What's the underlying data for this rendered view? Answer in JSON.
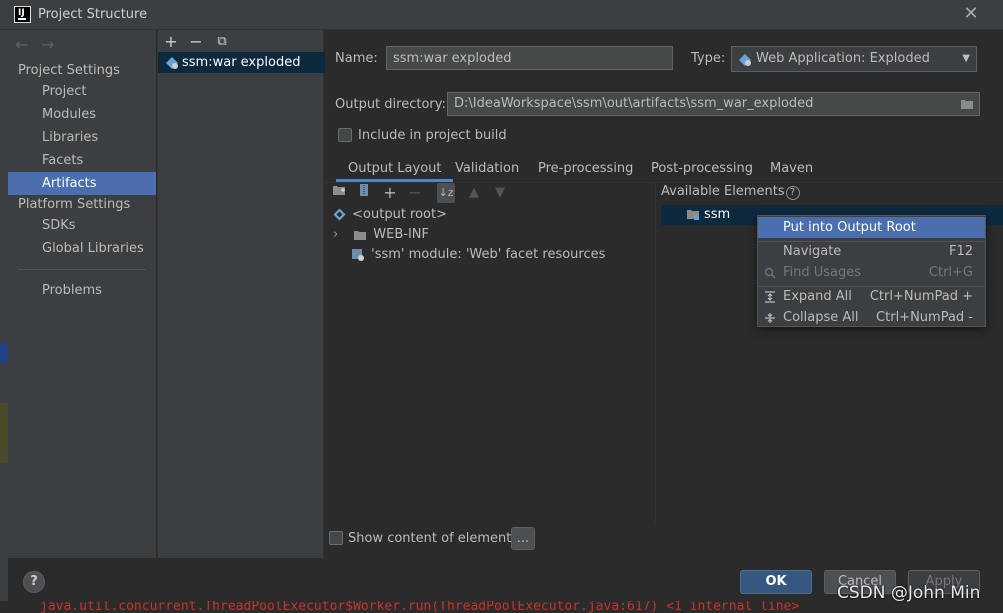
{
  "window": {
    "title": "Project Structure",
    "close": "✕"
  },
  "sidebar": {
    "back": "←",
    "forward": "→",
    "project_settings": "Project Settings",
    "items": [
      "Project",
      "Modules",
      "Libraries",
      "Facets",
      "Artifacts"
    ],
    "platform_settings": "Platform Settings",
    "platform_items": [
      "SDKs",
      "Global Libraries"
    ],
    "problems": "Problems",
    "selected": "Artifacts"
  },
  "artifacts": {
    "toolbar": {
      "add": "+",
      "remove": "−",
      "copy": "⧉"
    },
    "items": [
      "ssm:war exploded"
    ]
  },
  "form": {
    "name_label": "Name:",
    "name_value": "ssm:war exploded",
    "type_label": "Type:",
    "type_value": "Web Application: Exploded",
    "output_label": "Output directory:",
    "output_value": "D:\\IdeaWorkspace\\ssm\\out\\artifacts\\ssm_war_exploded",
    "include_label": "Include in project build"
  },
  "tabs": [
    "Output Layout",
    "Validation",
    "Pre-processing",
    "Post-processing",
    "Maven"
  ],
  "active_tab": "Output Layout",
  "layout_tree": [
    {
      "label": "<output root>",
      "icon": "output-root-icon"
    },
    {
      "label": "WEB-INF",
      "icon": "folder-icon",
      "expandable": true
    },
    {
      "label": "'ssm' module: 'Web' facet resources",
      "icon": "web-facet-icon"
    }
  ],
  "available": {
    "title": "Available Elements",
    "help": "?",
    "items": [
      "ssm"
    ]
  },
  "context_menu": {
    "items": [
      {
        "label": "Put into Output Root",
        "shortcut": "",
        "state": "selected"
      },
      {
        "label": "Navigate",
        "shortcut": "F12",
        "state": "normal"
      },
      {
        "label": "Find Usages",
        "shortcut": "Ctrl+G",
        "state": "disabled"
      },
      {
        "label": "Expand All",
        "shortcut": "Ctrl+NumPad +",
        "state": "normal"
      },
      {
        "label": "Collapse All",
        "shortcut": "Ctrl+NumPad -",
        "state": "normal"
      }
    ]
  },
  "show_content_label": "Show content of elements",
  "more_button": "...",
  "buttons": {
    "ok": "OK",
    "cancel": "Cancel",
    "apply": "Apply",
    "help": "?"
  },
  "bottom_code": "java.util.concurrent.ThreadPoolExecutor$Worker.run(ThreadPoolExecutor.java:617) <1 internal line>",
  "watermark": "CSDN @John Min",
  "colors": {
    "selection": "#4b6eaf",
    "ok_button": "#365880",
    "tab_underline": "#4a88c7"
  }
}
